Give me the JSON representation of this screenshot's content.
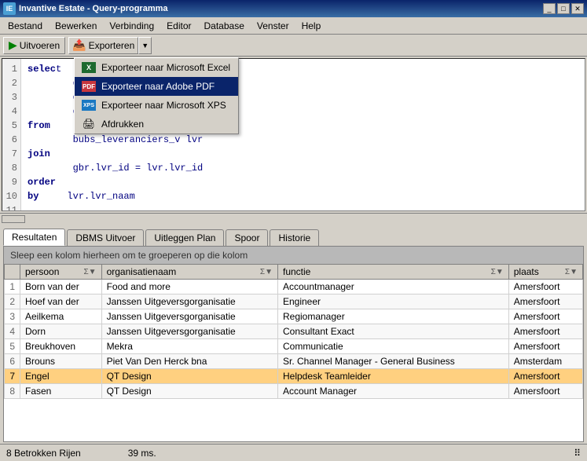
{
  "titleBar": {
    "title": "Invantive Estate - Query-programma",
    "icon": "IE",
    "controls": [
      "_",
      "□",
      "✕"
    ]
  },
  "menuBar": {
    "items": [
      "Bestand",
      "Bewerken",
      "Verbinding",
      "Editor",
      "Database",
      "Venster",
      "Help"
    ]
  },
  "toolbar": {
    "runLabel": "Uitvoeren",
    "exportLabel": "Exporteren",
    "arrowLabel": "▼"
  },
  "dropdown": {
    "items": [
      {
        "id": "excel",
        "label": "Exporteer naar Microsoft Excel",
        "iconType": "excel"
      },
      {
        "id": "pdf",
        "label": "Exporteer naar Adobe PDF",
        "iconType": "pdf",
        "active": true
      },
      {
        "id": "xps",
        "label": "Exporteer naar Microsoft XPS",
        "iconType": "xps"
      },
      {
        "id": "print",
        "label": "Afdrukken",
        "iconType": "print"
      }
    ]
  },
  "codeEditor": {
    "lines": [
      {
        "num": 1,
        "text": "selec"
      },
      {
        "num": 2,
        "text": "      "
      },
      {
        "num": 3,
        "text": "      "
      },
      {
        "num": 4,
        "text": "      "
      },
      {
        "num": 5,
        "text": ""
      },
      {
        "num": 6,
        "text": "from"
      },
      {
        "num": 7,
        "text": "      bubs_leveranciers_v lvr"
      },
      {
        "num": 8,
        "text": "join"
      },
      {
        "num": 9,
        "text": "      gbr.lvr_id = lvr.lvr_id"
      },
      {
        "num": 10,
        "text": "order"
      },
      {
        "num": 11,
        "text": "by     lvr.lvr_naam"
      }
    ],
    "codeLines": [
      {
        "num": 1,
        "content": "selec"
      },
      {
        "num": 2,
        "content": ""
      },
      {
        "num": 3,
        "content": ""
      },
      {
        "num": 4,
        "content": ""
      },
      {
        "num": 5,
        "content": ""
      },
      {
        "num": 6,
        "content": "from"
      },
      {
        "num": 7,
        "content": "      bubs_leveranciers_v lvr"
      },
      {
        "num": 8,
        "content": "join"
      },
      {
        "num": 9,
        "content": "      gbr.lvr_id = lvr.lvr_id"
      },
      {
        "num": 10,
        "content": "order"
      },
      {
        "num": 11,
        "content": "by     lvr.lvr_naam"
      }
    ]
  },
  "tabs": [
    {
      "id": "resultaten",
      "label": "Resultaten",
      "active": true
    },
    {
      "id": "dbms",
      "label": "DBMS Uitvoer",
      "active": false
    },
    {
      "id": "uitleggen",
      "label": "Uitleggen Plan",
      "active": false
    },
    {
      "id": "spoor",
      "label": "Spoor",
      "active": false
    },
    {
      "id": "historie",
      "label": "Historie",
      "active": false
    }
  ],
  "groupHeader": "Sleep een kolom hierheen om te groeperen op die kolom",
  "tableHeaders": [
    {
      "id": "persoon",
      "label": "persoon"
    },
    {
      "id": "organisatienaam",
      "label": "organisatienaam"
    },
    {
      "id": "functie",
      "label": "functie"
    },
    {
      "id": "plaats",
      "label": "plaats"
    }
  ],
  "tableRows": [
    {
      "num": 1,
      "persoon": "Born van der",
      "organisatienaam": "Food and more",
      "functie": "Accountmanager",
      "plaats": "Amersfoort",
      "highlighted": false
    },
    {
      "num": 2,
      "persoon": "Hoef van der",
      "organisatienaam": "Janssen Uitgeversgorganisatie",
      "functie": "Engineer",
      "plaats": "Amersfoort",
      "highlighted": false
    },
    {
      "num": 3,
      "persoon": "Aeilkema",
      "organisatienaam": "Janssen Uitgeversgorganisatie",
      "functie": "Regiomanager",
      "plaats": "Amersfoort",
      "highlighted": false
    },
    {
      "num": 4,
      "persoon": "Dorn",
      "organisatienaam": "Janssen Uitgeversgorganisatie",
      "functie": "Consultant Exact",
      "plaats": "Amersfoort",
      "highlighted": false
    },
    {
      "num": 5,
      "persoon": "Breukhoven",
      "organisatienaam": "Mekra",
      "functie": "Communicatie",
      "plaats": "Amersfoort",
      "highlighted": false
    },
    {
      "num": 6,
      "persoon": "Brouns",
      "organisatienaam": "Piet Van Den Herck bna",
      "functie": "Sr. Channel Manager - General Business",
      "plaats": "Amsterdam",
      "highlighted": false
    },
    {
      "num": 7,
      "persoon": "Engel",
      "organisatienaam": "QT Design",
      "functie": "Helpdesk Teamleider",
      "plaats": "Amersfoort",
      "highlighted": true
    },
    {
      "num": 8,
      "persoon": "Fasen",
      "organisatienaam": "QT Design",
      "functie": "Account Manager",
      "plaats": "Amersfoort",
      "highlighted": false
    }
  ],
  "statusBar": {
    "rowCount": "8 Betrokken Rijen",
    "time": "39 ms."
  }
}
